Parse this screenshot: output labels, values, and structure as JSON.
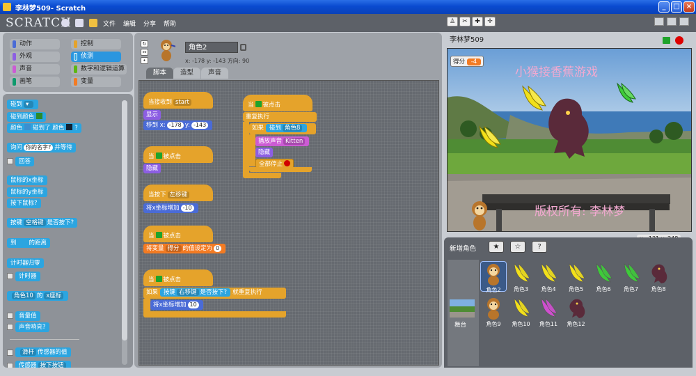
{
  "window": {
    "title": "李林梦509- Scratch"
  },
  "menu": {
    "logo": "SCRATCH",
    "items": [
      "文件",
      "编辑",
      "分享",
      "帮助"
    ]
  },
  "categories": [
    {
      "label": "动作",
      "color": "#4a6bd6"
    },
    {
      "label": "控制",
      "color": "#e5a32b"
    },
    {
      "label": "外观",
      "color": "#8c5ee3"
    },
    {
      "label": "侦测",
      "color": "#2ca5e0",
      "selected": true
    },
    {
      "label": "声音",
      "color": "#cc5bd4"
    },
    {
      "label": "数字和逻辑运算",
      "color": "#5cb712"
    },
    {
      "label": "画笔",
      "color": "#0e9a6c"
    },
    {
      "label": "变量",
      "color": "#f37b23"
    }
  ],
  "palette": {
    "touching": "碰到",
    "touching_color": "碰到颜色",
    "color_touching": {
      "a": "颜色",
      "b": "碰到了 颜色",
      "c": "?"
    },
    "ask": {
      "a": "询问",
      "input": "你的名字?",
      "b": "并等待"
    },
    "answer": "回答",
    "mouse_x": "鼠标的x坐标",
    "mouse_y": "鼠标的y坐标",
    "mouse_down": "按下鼠标?",
    "key_pressed": {
      "a": "按键",
      "key": "空格键",
      "b": "是否按下?"
    },
    "distance": {
      "a": "到",
      "b": "的距离"
    },
    "timer_reset": "计时器归零",
    "timer": "计时器",
    "of_block": {
      "sprite": "角色10",
      "a": "的",
      "prop": "x座标"
    },
    "loudness": "音量值",
    "loud": "声音响亮?",
    "slider": {
      "a": "滑杆",
      "b": "传感器的值"
    },
    "sensor": {
      "a": "传感器",
      "b": "按下按钮"
    }
  },
  "sprite": {
    "name": "角色2",
    "x_label": "x: -178",
    "y_label": "y: -143",
    "dir_label": "方向: 90"
  },
  "tabs": [
    "脚本",
    "造型",
    "声音"
  ],
  "scripts": {
    "s1_hat": "当接收到",
    "s1_msg": "start",
    "s1_show": "显示",
    "s1_goto": "移到 x:",
    "s1_gx": "-178",
    "s1_gy_label": "y:",
    "s1_gy": "-143",
    "s2_hat": "当",
    "s2_hat_b": "被点击",
    "s2_hide": "隐藏",
    "s3_hat": "当按下",
    "s3_key": "左移键",
    "s3_change": "将x坐标增加",
    "s3_val": "-10",
    "s4_hat": "当",
    "s4_hat_b": "被点击",
    "s4_set": "将变量",
    "s4_var": "得分",
    "s4_set_b": "的值设定为",
    "s4_val": "0",
    "s5_hat": "当",
    "s5_hat_b": "被点击",
    "s5_if": "如果",
    "s5_key_a": "按键",
    "s5_key": "右移键",
    "s5_key_b": "是否按下?",
    "s5_repeat": "就重复执行",
    "s5_change": "将x坐标增加",
    "s5_val": "10",
    "s6_hat": "当",
    "s6_hat_b": "被点击",
    "s6_forever": "重复执行",
    "s6_if": "如果",
    "s6_touch": "碰到",
    "s6_target": "角色8",
    "s6_play": "播放声音",
    "s6_sound": "Kitten",
    "s6_hide": "隐藏",
    "s6_stop": "全部停止"
  },
  "stage": {
    "project": "李林梦509",
    "score_label": "得分",
    "score_value": "-4",
    "game_title": "小猴接香蕉游戏",
    "copyright": "版权所有: 李林梦",
    "mouse_x": "x: -131",
    "mouse_y": "y: 248"
  },
  "library": {
    "new_sprite": "新增角色",
    "stage_label": "舞台",
    "sprites": [
      {
        "name": "角色2",
        "kind": "monkey-icon",
        "selected": true
      },
      {
        "name": "角色3",
        "kind": "banana-icon",
        "color": "#f2e01a"
      },
      {
        "name": "角色4",
        "kind": "banana-icon",
        "color": "#f2e01a"
      },
      {
        "name": "角色5",
        "kind": "banana-icon",
        "color": "#f2e01a"
      },
      {
        "name": "角色6",
        "kind": "banana-icon",
        "color": "#3ecb3a"
      },
      {
        "name": "角色7",
        "kind": "banana-icon",
        "color": "#3ecb3a"
      },
      {
        "name": "角色8",
        "kind": "monster-icon"
      },
      {
        "name": "角色9",
        "kind": "monkey-icon"
      },
      {
        "name": "角色10",
        "kind": "banana-icon",
        "color": "#f2e01a"
      },
      {
        "name": "角色11",
        "kind": "banana-icon",
        "color": "#d04fd0"
      },
      {
        "name": "角色12",
        "kind": "monster-icon"
      }
    ]
  }
}
